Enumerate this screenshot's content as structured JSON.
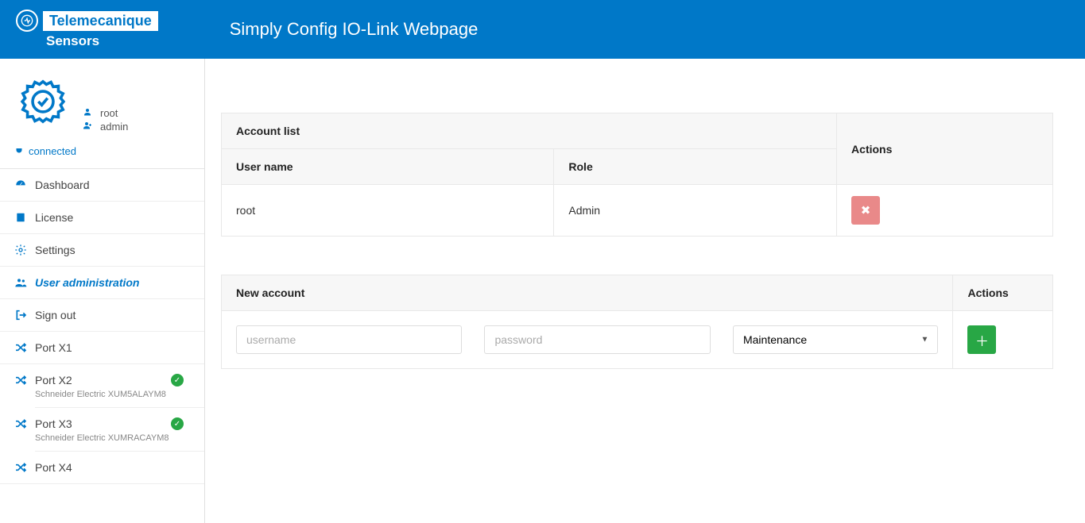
{
  "header": {
    "brand": "Telemecanique",
    "sub_brand": "Sensors",
    "title": "Simply Config IO-Link Webpage"
  },
  "user": {
    "name": "root",
    "role": "admin",
    "connection": "connected"
  },
  "nav": {
    "dashboard": "Dashboard",
    "license": "License",
    "settings": "Settings",
    "user_admin": "User administration",
    "sign_out": "Sign out",
    "port_x1": "Port X1",
    "port_x2": "Port X2",
    "port_x2_sub": "Schneider Electric XUM5ALAYM8",
    "port_x3": "Port X3",
    "port_x3_sub": "Schneider Electric XUMRACAYM8",
    "port_x4": "Port X4"
  },
  "account_list": {
    "header": "Account list",
    "col_user": "User name",
    "col_role": "Role",
    "col_actions": "Actions",
    "rows": [
      {
        "user": "root",
        "role": "Admin"
      }
    ]
  },
  "new_account": {
    "header": "New account",
    "col_actions": "Actions",
    "username_placeholder": "username",
    "password_placeholder": "password",
    "role_selected": "Maintenance"
  }
}
